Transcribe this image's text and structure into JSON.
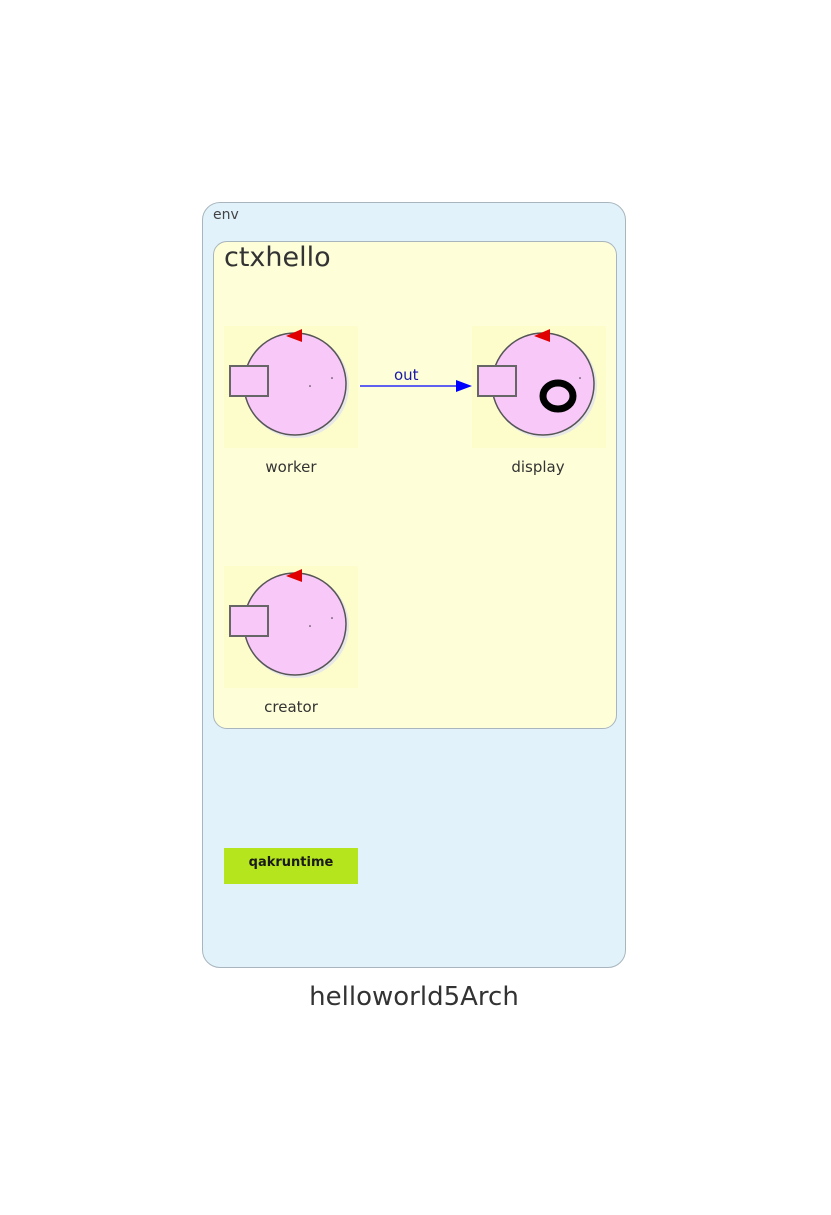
{
  "env": {
    "label": "env"
  },
  "context": {
    "label": "ctxhello"
  },
  "actors": [
    {
      "name": "worker"
    },
    {
      "name": "display"
    },
    {
      "name": "creator"
    }
  ],
  "edge": {
    "label": "out",
    "color": "#0000ff"
  },
  "runtime": {
    "label": "qakruntime",
    "color": "#b5e61d"
  },
  "title": "helloworld5Arch",
  "colors": {
    "env_bg": "#e1f2fb",
    "ctx_bg": "#fefed9",
    "actor_fill": "#f8c8f8",
    "pointer": "#e00000"
  }
}
